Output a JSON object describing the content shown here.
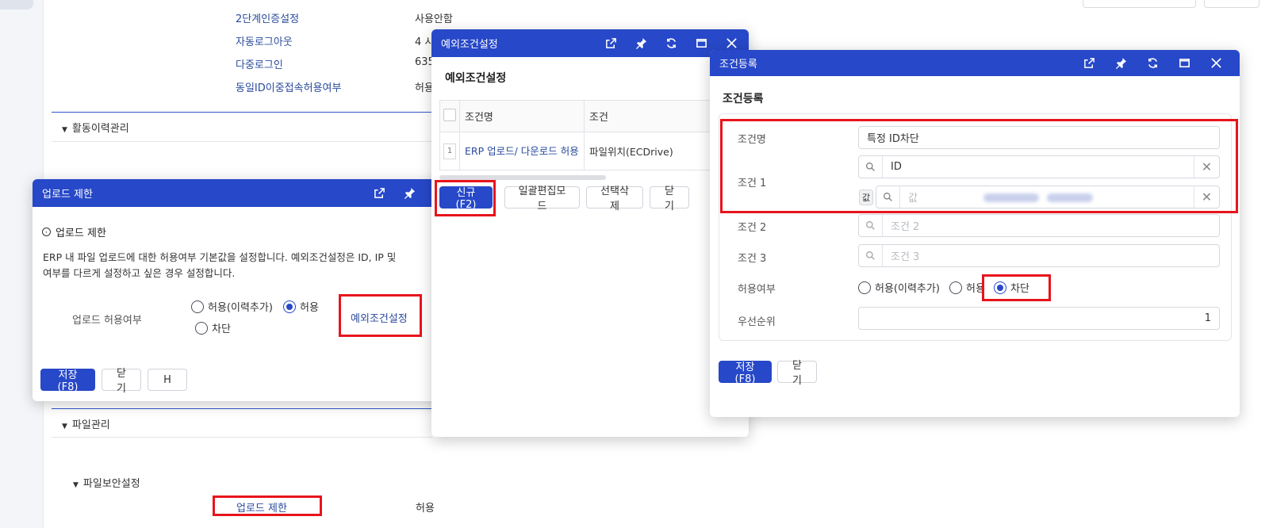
{
  "background": {
    "rows": [
      {
        "label": "2단계인증설정",
        "value": "사용안함"
      },
      {
        "label": "자동로그아웃",
        "value": "4 시"
      },
      {
        "label": "다중로그인",
        "value": "635"
      },
      {
        "label": "동일ID이중접속허용여부",
        "value": "허용"
      }
    ],
    "section_activity": "활동이력관리",
    "section_file": "파일관리",
    "subsection_file_security": "파일보안설정",
    "upload_row": {
      "label": "업로드 제한",
      "value": "허용"
    }
  },
  "upload_popup": {
    "title": "업로드 제한",
    "heading": "업로드 제한",
    "description_line1": "ERP 내 파일 업로드에 대한 허용여부 기본값을 설정합니다. 예외조건설정은 ID, IP 및 ",
    "description_line2": "여부를 다르게 설정하고 싶은 경우 설정합니다.",
    "allow_label": "업로드 허용여부",
    "radio_options": [
      "허용(이력추가)",
      "허용",
      "차단"
    ],
    "selected": "허용",
    "exception_link": "예외조건설정",
    "buttons": {
      "save": "저장(F8)",
      "close": "닫기",
      "h": "H"
    }
  },
  "exception_popup": {
    "title": "예외조건설정",
    "heading": "예외조건설정",
    "columns": [
      "조건명",
      "조건"
    ],
    "rows": [
      {
        "num": "1",
        "name": "ERP 업로드/ 다운로드 허용",
        "condition": "파일위치(ECDrive)"
      }
    ],
    "buttons": {
      "new": "신규(F2)",
      "bulk_edit": "일괄편집모드",
      "delete_selected": "선택삭제",
      "close": "닫기"
    }
  },
  "register_popup": {
    "title": "조건등록",
    "heading": "조건등록",
    "name_label": "조건명",
    "name_value": "특정 ID차단",
    "cond1_label": "조건 1",
    "cond1_value": "ID",
    "value_tag": "값",
    "value_placeholder": "값",
    "cond2_label": "조건 2",
    "cond2_placeholder": "조건 2",
    "cond3_label": "조건 3",
    "cond3_placeholder": "조건 3",
    "allow_label": "허용여부",
    "radio_options": [
      "허용(이력추가)",
      "허용",
      "차단"
    ],
    "selected": "차단",
    "priority_label": "우선순위",
    "priority_value": "1",
    "buttons": {
      "save": "저장(F8)",
      "close": "닫기"
    }
  },
  "colors": {
    "header_blue": "#2748c8",
    "highlight_red": "#e8141c",
    "link_blue": "#2a4a9c"
  }
}
